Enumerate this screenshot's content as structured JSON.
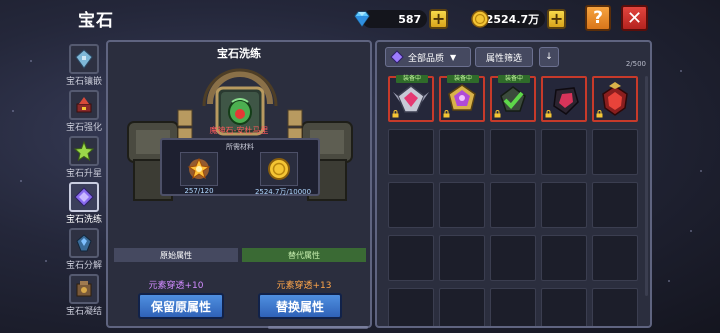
{
  "header": {
    "title": "宝石",
    "diamonds": "587",
    "gold": "2524.7万",
    "help_label": "?",
    "close_label": "✕"
  },
  "sidebar": {
    "items": [
      {
        "label": "宝石镶嵌",
        "icon": "gem-inlay-icon",
        "active": false
      },
      {
        "label": "宝石强化",
        "icon": "gem-enhance-icon",
        "active": false
      },
      {
        "label": "宝石升星",
        "icon": "star-icon",
        "active": false
      },
      {
        "label": "宝石洗练",
        "icon": "gem-refine-icon",
        "active": true
      },
      {
        "label": "宝石分解",
        "icon": "gem-decompose-icon",
        "active": false
      },
      {
        "label": "宝石凝结",
        "icon": "gem-condense-icon",
        "active": false
      }
    ]
  },
  "refine": {
    "title": "宝石洗练",
    "gem_name": "魔神石-安杜马里",
    "materials_title": "所需材料",
    "material_1_count": "257/120",
    "material_2_count": "2524.7万/10000",
    "original_attr_header": "原始属性",
    "new_attr_header": "替代属性",
    "original_attr_value": "元素穿透+10",
    "new_attr_value": "元素穿透+13",
    "keep_button": "保留原属性",
    "replace_button": "替换属性"
  },
  "inventory": {
    "quality_filter": "全部品质",
    "attr_filter": "属性筛选",
    "sort_label": "↓",
    "capacity": "2/500",
    "equipped_tag": "装备中",
    "items": [
      {
        "gem": "silver-red-gem",
        "equipped": true
      },
      {
        "gem": "gold-purple-gem",
        "equipped": true
      },
      {
        "gem": "green-gem",
        "equipped": true
      },
      {
        "gem": "dark-red-gem",
        "equipped": false
      },
      {
        "gem": "red-crest-gem",
        "equipped": false
      }
    ]
  },
  "colors": {
    "accent_blue": "#2f62b8",
    "equipped_green": "#2f6b2a",
    "rarity_red": "#c73a2a",
    "gem_name_red": "#ff5c5c",
    "original_attr_purple": "#d18bff",
    "new_attr_orange": "#ffa64a"
  }
}
